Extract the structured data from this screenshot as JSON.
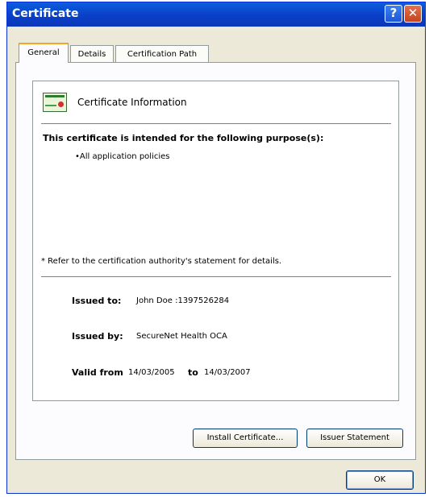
{
  "window": {
    "title": "Certificate",
    "help_label": "?",
    "close_label": "✕"
  },
  "tabs": [
    {
      "label": "General"
    },
    {
      "label": "Details"
    },
    {
      "label": "Certification Path"
    }
  ],
  "info": {
    "title": "Certificate Information",
    "purpose_heading": "This certificate is intended for the following purpose(s):",
    "purpose_items": [
      "•All application policies"
    ],
    "note": "* Refer to the certification authority's statement for details.",
    "issued_to_label": "Issued to:",
    "issued_to_value": "John Doe :1397526284",
    "issued_by_label": "Issued by:",
    "issued_by_value": "SecureNet Health OCA",
    "valid_from_label": "Valid from",
    "valid_from_value": "14/03/2005",
    "valid_to_label": "to",
    "valid_to_value": "14/03/2007"
  },
  "buttons": {
    "install": "Install Certificate...",
    "issuer": "Issuer Statement",
    "ok": "OK"
  },
  "colors": {
    "titlebar": "#0a46d0",
    "dialog_bg": "#ece9d8",
    "active_tab_accent": "#f5a623"
  }
}
